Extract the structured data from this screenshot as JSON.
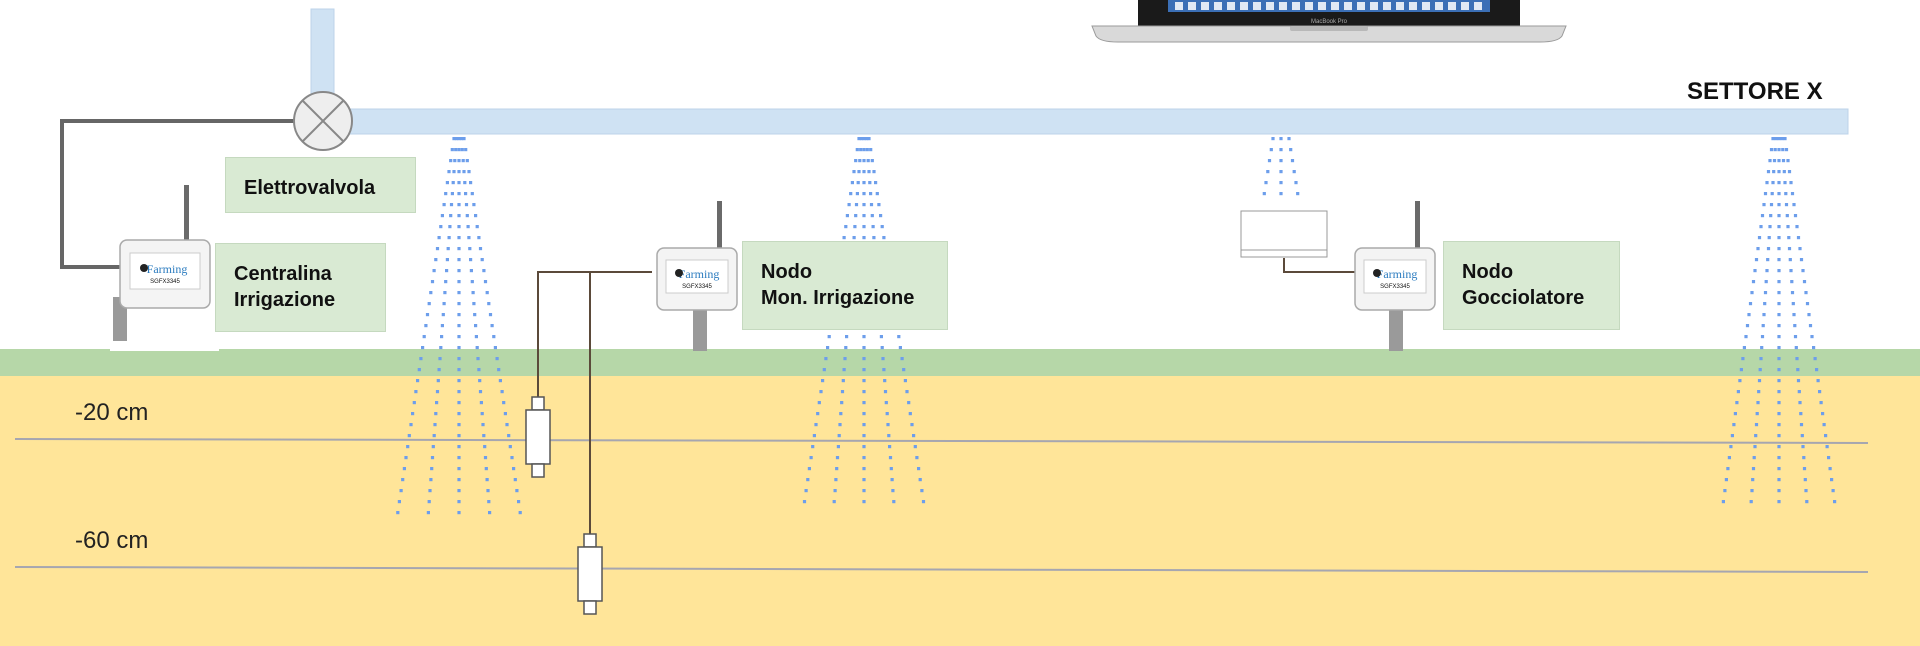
{
  "sector_title": "SETTORE X",
  "labels": {
    "valve": "Elettrovalvola",
    "controller_line1": "Centralina",
    "controller_line2": "Irrigazione",
    "monitor_line1": "Nodo",
    "monitor_line2": "Mon. Irrigazione",
    "dripper_line1": "Nodo",
    "dripper_line2": "Gocciolatore"
  },
  "depths": {
    "d20": "-20 cm",
    "d60": "-60 cm"
  },
  "device": {
    "brand": "Farming",
    "code": "SGFX3345"
  },
  "laptop": {
    "model": "MacBook Pro"
  },
  "colors": {
    "pipe": "#cfe2f3",
    "grass": "#b6d7a8",
    "soil": "#ffe599",
    "spray": "#6d9eeb",
    "label_box": "#d9ead3",
    "wire": "#5b4a3a",
    "depth_line": "#a6a6b0"
  }
}
